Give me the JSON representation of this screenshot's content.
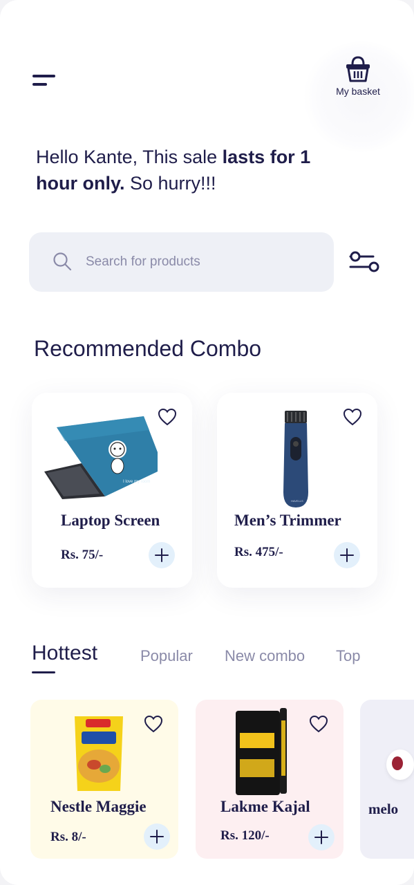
{
  "header": {
    "menu_icon": "hamburger-menu-icon",
    "basket_icon": "basket-icon",
    "basket_label": "My basket"
  },
  "greeting": {
    "prefix": "Hello Kante, This sale ",
    "emphasis1": "lasts for 1 hour only.",
    "suffix": " So hurry!!!"
  },
  "search": {
    "placeholder": "Search for products",
    "value": "",
    "icon": "search-icon",
    "filter_icon": "filter-icon"
  },
  "recommended": {
    "title": "Recommended Combo",
    "items": [
      {
        "name": "Laptop Screen",
        "price": "Rs. 75/-",
        "image": "laptop-skin-image"
      },
      {
        "name": "Men’s Trimmer",
        "price": "Rs. 475/-",
        "image": "trimmer-image"
      }
    ]
  },
  "tabs": [
    {
      "label": "Hottest",
      "active": true
    },
    {
      "label": "Popular",
      "active": false
    },
    {
      "label": "New combo",
      "active": false
    },
    {
      "label": "Top",
      "active": false
    }
  ],
  "hottest": [
    {
      "name": "Nestle Maggie",
      "price": "Rs. 8/-",
      "bg": "#fffbe8"
    },
    {
      "name": "Lakme Kajal",
      "price": "Rs. 120/-",
      "bg": "#fdeff1"
    },
    {
      "name": "melo",
      "price": "",
      "bg": "#efeff7"
    }
  ],
  "colors": {
    "primary_text": "#1f1d4a",
    "muted_text": "#8a8aa8",
    "add_button_bg": "#e3f0fb",
    "search_bg": "#eef0f6"
  }
}
